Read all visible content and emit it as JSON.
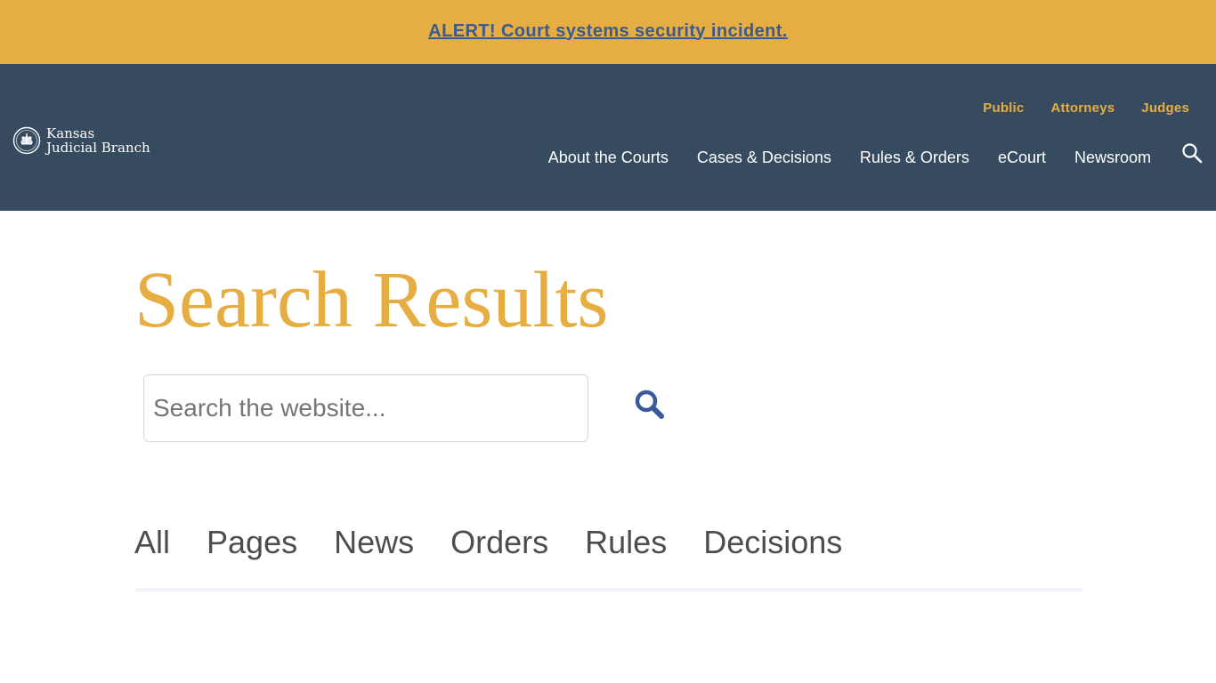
{
  "alert": {
    "text": "ALERT! Court systems security incident."
  },
  "header": {
    "logo": {
      "line1": "Kansas",
      "line2": "Judicial Branch"
    },
    "audience_nav": [
      "Public",
      "Attorneys",
      "Judges"
    ],
    "main_nav": [
      "About the Courts",
      "Cases & Decisions",
      "Rules & Orders",
      "eCourt",
      "Newsroom"
    ],
    "search_icon": "search-icon"
  },
  "main": {
    "title": "Search Results",
    "search": {
      "placeholder": "Search the website...",
      "value": ""
    },
    "tabs": [
      "All",
      "Pages",
      "News",
      "Orders",
      "Rules",
      "Decisions"
    ]
  },
  "colors": {
    "alert_bg": "#e6ae42",
    "alert_link": "#3b5a8e",
    "header_bg": "#364b60",
    "accent_gold": "#e6ae42",
    "search_button": "#3b5a9e"
  }
}
